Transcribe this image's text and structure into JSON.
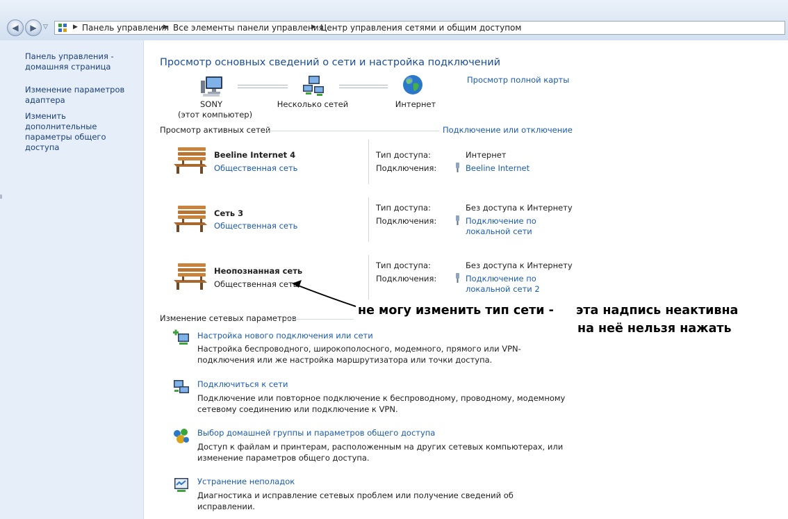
{
  "breadcrumbs": [
    "Панель управления",
    "Все элементы панели управления",
    "Центр управления сетями и общим доступом"
  ],
  "left_pane": {
    "links": [
      "Панель управления - домашняя страница",
      "Изменение параметров адаптера",
      "Изменить дополнительные параметры общего доступа"
    ]
  },
  "main": {
    "title": "Просмотр основных сведений о сети и настройка подключений",
    "map": {
      "computer_name": "SONY",
      "computer_sub": "(этот компьютер)",
      "multiple_networks": "Несколько сетей",
      "internet": "Интернет",
      "full_map_link": "Просмотр полной карты"
    },
    "active_networks": {
      "heading": "Просмотр активных сетей",
      "connect_link": "Подключение или отключение",
      "access_label": "Тип доступа:",
      "connections_label": "Подключения:",
      "networks": [
        {
          "name": "Beeline Internet  4",
          "type": "Общественная сеть",
          "access": "Интернет",
          "connection": [
            "Beeline Internet"
          ]
        },
        {
          "name": "Сеть  3",
          "type": "Общественная сеть",
          "access": "Без доступа к Интернету",
          "connection": [
            "Подключение по",
            "локальной сети"
          ]
        },
        {
          "name": "Неопознанная сеть",
          "type": "Общественная сеть",
          "access": "Без доступа к Интернету",
          "connection": [
            "Подключение по",
            "локальной сети 2"
          ]
        }
      ]
    },
    "change_settings": {
      "heading": "Изменение сетевых параметров",
      "tasks": [
        {
          "title": "Настройка нового подключения или сети",
          "desc": "Настройка беспроводного, широкополосного, модемного, прямого или VPN-подключения или же настройка маршрутизатора или точки доступа."
        },
        {
          "title": "Подключиться к сети",
          "desc": "Подключение или повторное подключение к беспроводному, проводному, модемному сетевому соединению или подключение к VPN."
        },
        {
          "title": "Выбор домашней группы и параметров общего доступа",
          "desc": "Доступ к файлам и принтерам, расположенным на других сетевых компьютерах, или изменение параметров общего доступа."
        },
        {
          "title": "Устранение неполадок",
          "desc": "Диагностика и исправление сетевых проблем или получение сведений об исправлении."
        }
      ]
    }
  },
  "annotation": {
    "line1a": "не могу изменить тип сети -",
    "line1b": "эта надпись неактивна",
    "line2": "на неё нельзя нажать"
  }
}
